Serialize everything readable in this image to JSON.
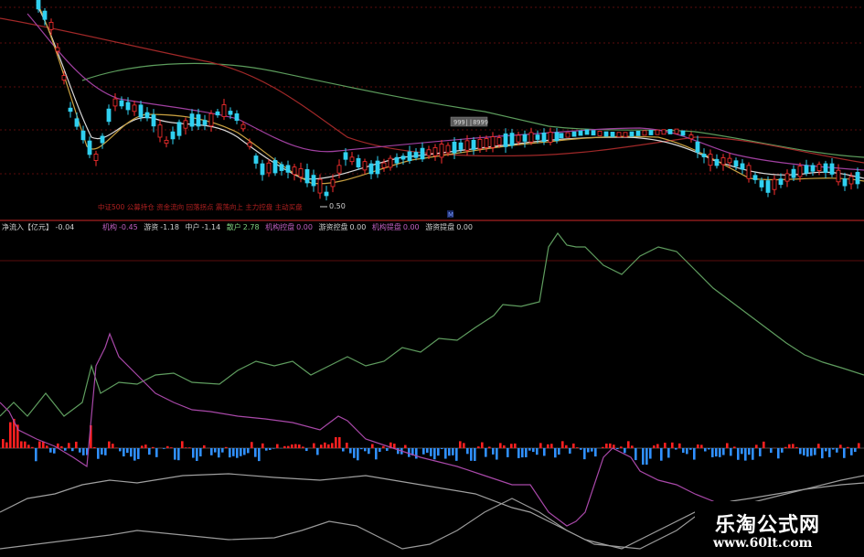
{
  "upper_panel": {
    "tag_box": "999||8999",
    "low_price": "0.50",
    "marker": "M",
    "annotation": "中证500 公募持仓 资金流向 回落拐点 震荡向上 主力控盘 主动买盘"
  },
  "indicator_bar": {
    "title": "净流入【亿元】",
    "title_value": "-0.04",
    "items": [
      {
        "label": "机构",
        "value": "-0.45",
        "color": "#c060c0"
      },
      {
        "label": "游资",
        "value": "-1.18",
        "color": "#d0d0d0"
      },
      {
        "label": "中户",
        "value": "-1.14",
        "color": "#d0d0d0"
      },
      {
        "label": "散户",
        "value": "2.78",
        "color": "#7fd07f"
      },
      {
        "label": "机构控盘",
        "value": "0.00",
        "color": "#c060c0"
      },
      {
        "label": "游资控盘",
        "value": "0.00",
        "color": "#d0d0d0"
      },
      {
        "label": "机构提盘",
        "value": "0.00",
        "color": "#c060c0"
      },
      {
        "label": "游资提盘",
        "value": "0.00",
        "color": "#d0d0d0"
      }
    ]
  },
  "watermark": {
    "title": "乐淘公式网",
    "url": "www.60lt.com"
  },
  "colors": {
    "bull_candle": "#ff3030",
    "bear_candle": "#30d0f0",
    "net_inflow_pos": "#ff2020",
    "net_inflow_neg": "#3090ff",
    "institution_line": "#b050b0",
    "retail_line": "#60a060",
    "hot_money_line": "#b0b0b0",
    "grid": "#6a1010"
  }
}
